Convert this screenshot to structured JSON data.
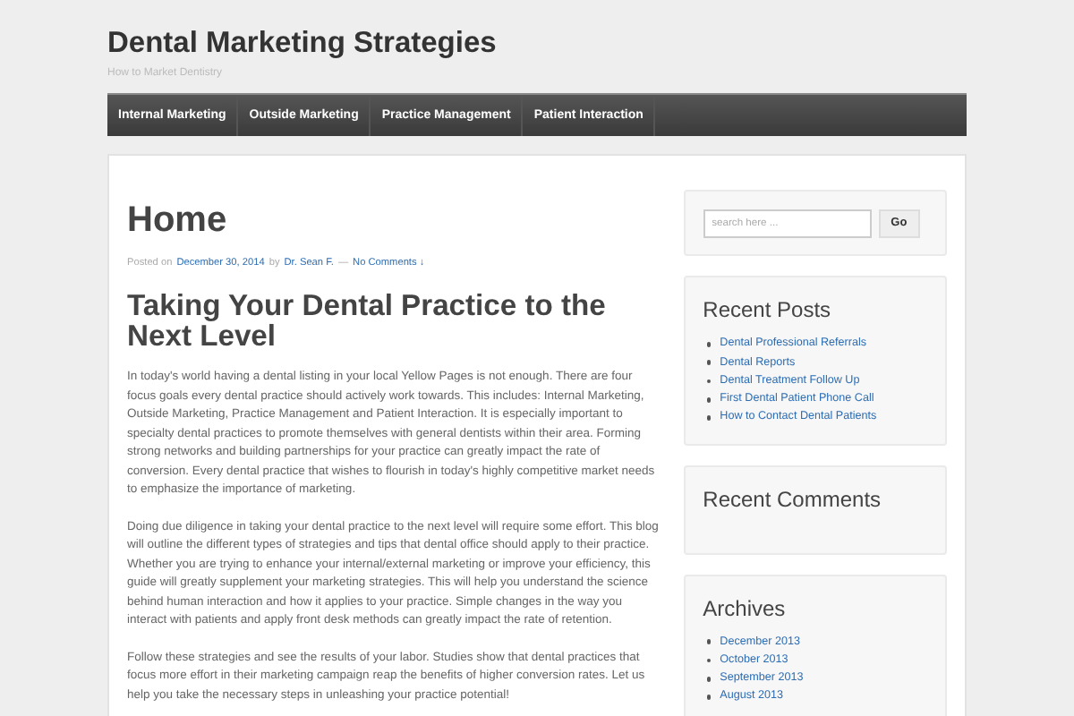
{
  "site": {
    "title": "Dental Marketing Strategies",
    "tagline": "How to Market Dentistry"
  },
  "nav": [
    {
      "label": "Internal Marketing"
    },
    {
      "label": "Outside Marketing"
    },
    {
      "label": "Practice Management"
    },
    {
      "label": "Patient Interaction"
    }
  ],
  "page": {
    "title": "Home",
    "meta": {
      "posted_on": "Posted on",
      "date": "December 30, 2014",
      "by": "by",
      "author": "Dr. Sean F.",
      "dash": "—",
      "comments": "No Comments ↓"
    },
    "heading": "Taking Your Dental Practice to the Next Level",
    "paragraphs": [
      "In today's world having a dental listing in your local Yellow Pages is not enough. There are four focus goals every dental practice should actively work towards. This includes: Internal Marketing, Outside Marketing, Practice Management and Patient Interaction. It is especially important to specialty dental practices to promote themselves with general dentists within their area. Forming strong networks and building partnerships for your practice can greatly impact the rate of conversion. Every dental practice that wishes to flourish in today's highly competitive market needs to emphasize the importance of marketing.",
      "Doing due diligence in taking your dental practice to the next level will require some effort. This blog will outline the different types of strategies and tips that dental office should apply to their practice. Whether you are trying to enhance your internal/external marketing or improve your efficiency, this guide will greatly supplement your marketing strategies. This will help you understand the science behind human interaction and how it applies to your practice. Simple changes in the way you interact with patients and apply front desk methods can greatly impact the rate of retention.",
      "Follow these strategies and see the results of your labor. Studies show that dental practices that focus more effort in their marketing campaign reap the benefits of higher conversion rates. Let us help you take the necessary steps in unleashing your practice potential!"
    ]
  },
  "sidebar": {
    "search": {
      "placeholder": "search here ...",
      "button": "Go"
    },
    "widgets": [
      {
        "title": "Recent Posts",
        "items": [
          "Dental Professional Referrals",
          "Dental Reports",
          "Dental Treatment Follow Up",
          "First Dental Patient Phone Call",
          "How to Contact Dental Patients"
        ]
      },
      {
        "title": "Recent Comments"
      },
      {
        "title": "Archives",
        "items": [
          "December 2013",
          "October 2013",
          "September 2013",
          "August 2013"
        ]
      }
    ]
  }
}
